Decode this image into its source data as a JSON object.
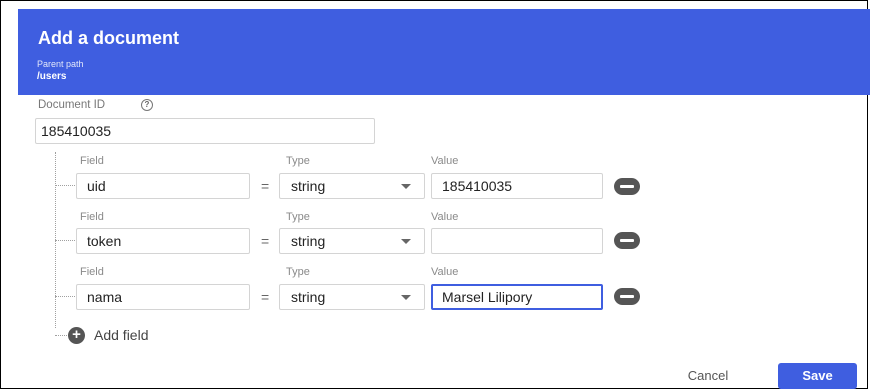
{
  "dialog": {
    "title": "Add a document",
    "parent_path_label": "Parent path",
    "parent_path_value": "/users"
  },
  "document_id": {
    "label": "Document ID",
    "help_icon": "?",
    "value": "185410035"
  },
  "columns": {
    "field": "Field",
    "type": "Type",
    "value": "Value"
  },
  "fields": [
    {
      "name": "uid",
      "equals": "=",
      "type": "string",
      "value": "185410035"
    },
    {
      "name": "token",
      "equals": "=",
      "type": "string",
      "value": ""
    },
    {
      "name": "nama",
      "equals": "=",
      "type": "string",
      "value": "Marsel Lilipory"
    }
  ],
  "add_field": {
    "icon": "+",
    "label": "Add field"
  },
  "actions": {
    "cancel": "Cancel",
    "save": "Save"
  },
  "colors": {
    "accent": "#3f5ee0",
    "icon_dark": "#555555"
  },
  "icons": {
    "help": "help-circle-icon",
    "remove": "remove-circle-icon",
    "add": "add-circle-icon",
    "dropdown": "caret-down-icon"
  }
}
